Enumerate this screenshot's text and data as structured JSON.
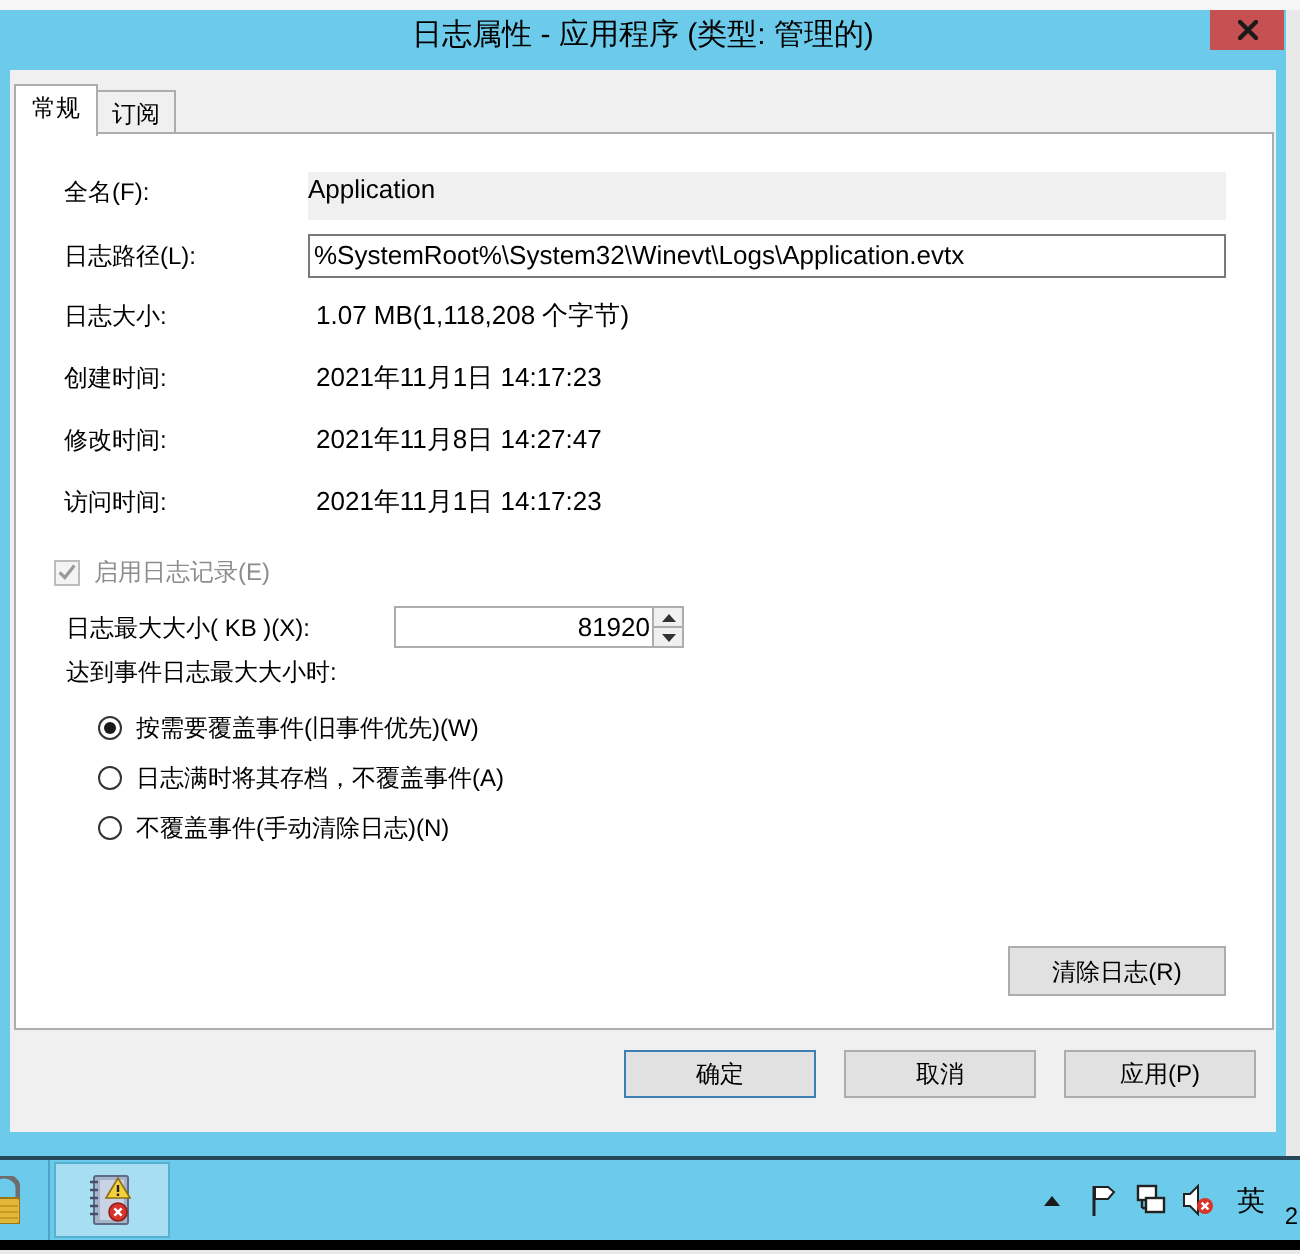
{
  "window": {
    "title": "日志属性 - 应用程序 (类型: 管理的)"
  },
  "tabs": [
    {
      "label": "常规",
      "selected": true
    },
    {
      "label": "订阅",
      "selected": false
    }
  ],
  "fields": [
    {
      "kind": "shaded",
      "label": "全名(F):",
      "value": "Application"
    },
    {
      "kind": "input",
      "label": "日志路径(L):",
      "value": "%SystemRoot%\\System32\\Winevt\\Logs\\Application.evtx"
    },
    {
      "kind": "text",
      "label": "日志大小:",
      "value": "1.07 MB(1,118,208 个字节)"
    },
    {
      "kind": "text",
      "label": "创建时间:",
      "value": "2021年11月1日 14:17:23"
    },
    {
      "kind": "text",
      "label": "修改时间:",
      "value": "2021年11月8日 14:27:47"
    },
    {
      "kind": "text",
      "label": "访问时间:",
      "value": "2021年11月1日 14:17:23"
    }
  ],
  "enable_logging": {
    "label": "启用日志记录(E)",
    "checked": true,
    "disabled": true
  },
  "max_size": {
    "label": "日志最大大小( KB )(X):",
    "value": "81920"
  },
  "policy": {
    "label": "达到事件日志最大大小时:",
    "options": [
      {
        "label": "按需要覆盖事件(旧事件优先)(W)",
        "selected": true
      },
      {
        "label": "日志满时将其存档，不覆盖事件(A)",
        "selected": false
      },
      {
        "label": "不覆盖事件(手动清除日志)(N)",
        "selected": false
      }
    ]
  },
  "clear_button": {
    "label": "清除日志(R)"
  },
  "buttons": [
    {
      "label": "确定",
      "default": true
    },
    {
      "label": "取消",
      "default": false
    },
    {
      "label": "应用(P)",
      "default": false
    }
  ],
  "taskbar": {
    "ime": "英",
    "clock": "2"
  }
}
